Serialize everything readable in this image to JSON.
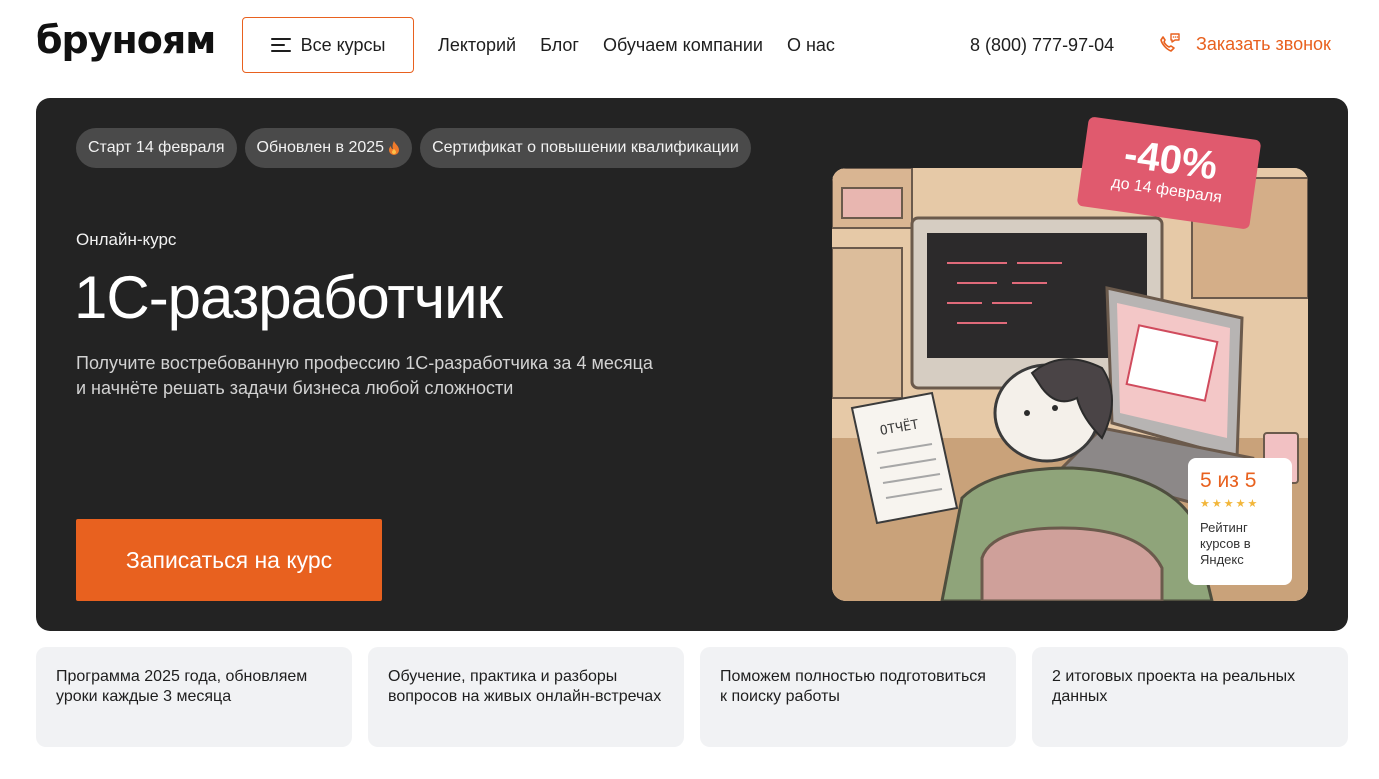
{
  "header": {
    "logo": "бруноям",
    "all_courses_label": "Все курсы",
    "nav": [
      "Лекторий",
      "Блог",
      "Обучаем компании",
      "О нас"
    ],
    "phone": "8 (800) 777-97-04",
    "callback_label": "Заказать звонок"
  },
  "hero": {
    "chips": [
      "Старт 14 февраля",
      "Обновлен в 2025",
      "Сертификат о повышении квалификации"
    ],
    "kicker": "Онлайн-курс",
    "title": "1С-разработчик",
    "subtitle": "Получите востребованную профессию 1С-разработчика за 4 месяца и начнёте решать задачи бизнеса любой сложности",
    "cta_label": "Записаться на курс",
    "discount": "-40%",
    "discount_until": "до 14 февраля",
    "illustration_text": "ОТЧЁТ",
    "rating": {
      "score": "5 из 5",
      "stars": 5,
      "caption": "Рейтинг курсов в Яндекс"
    }
  },
  "features": [
    "Программа 2025 года, обновляем уроки каждые 3 месяца",
    "Обучение, практика и разборы вопросов на живых онлайн-встречах",
    "Поможем полностью подготовиться к поиску работы",
    "2 итоговых проекта на реальных данных"
  ],
  "colors": {
    "accent": "#e8611f",
    "hero_bg": "#232323",
    "badge": "#e05a6e",
    "card_bg": "#f1f2f4"
  },
  "icons": {
    "menu": "burger-menu-icon",
    "callback": "phone-callback-icon",
    "fire": "fire-icon",
    "star": "star-icon"
  }
}
